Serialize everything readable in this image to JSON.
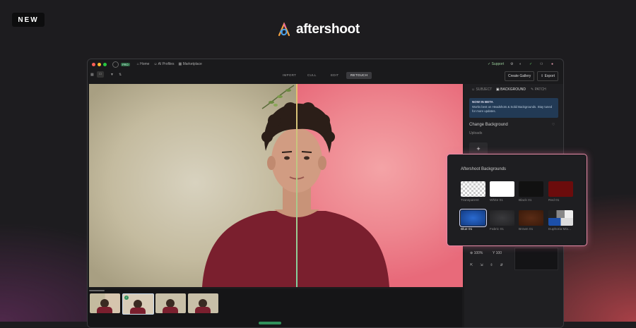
{
  "badge": {
    "label": "NEW"
  },
  "brand": {
    "name": "aftershoot"
  },
  "app": {
    "titlebar": {
      "pro_badge": "PRO",
      "nav": [
        {
          "label": "Home",
          "icon": "home-icon"
        },
        {
          "label": "AI Profiles",
          "icon": "ai-profiles-icon"
        },
        {
          "label": "Marketplace",
          "icon": "marketplace-icon"
        }
      ],
      "support": "Support"
    },
    "modes": [
      "IMPORT",
      "CULL",
      "EDIT",
      "RETOUCH"
    ],
    "active_mode": "RETOUCH",
    "actions": {
      "create_gallery": "Create Gallery",
      "export": "Export"
    },
    "panel": {
      "tabs": [
        "SUBJECT",
        "BACKGROUND",
        "PATCH"
      ],
      "active_tab": "BACKGROUND",
      "beta_title": "NOW IN BETA",
      "beta_text": "Works best on Headshots & Solid Backgrounds. Stay tuned for more updates.",
      "section_title": "Change Background",
      "uploads_label": "Uploads",
      "add_symbol": "+",
      "zoom_value": "100%",
      "zoom_value_2": "100"
    }
  },
  "popup": {
    "title": "Aftershoot Backgrounds",
    "swatches": [
      {
        "label": "Transparent",
        "color": "#ffffff"
      },
      {
        "label": "White 01",
        "color": "#ffffff"
      },
      {
        "label": "Black 01",
        "color": "#111111"
      },
      {
        "label": "Red 01",
        "color": "#6b0c0c"
      },
      {
        "label": "Blue 01",
        "color": "#1c4fa8"
      },
      {
        "label": "Fabric 01",
        "color": "#2b2b2d"
      },
      {
        "label": "Brown 01",
        "color": "#4a2412"
      },
      {
        "label": "Euphoria Mix...",
        "color": "#888888"
      }
    ],
    "selected": "Blue 01"
  },
  "colors": {
    "accent_green": "#2f8f5a",
    "highlight_pink": "#e58aa6",
    "shirt": "#7a1f2e"
  }
}
